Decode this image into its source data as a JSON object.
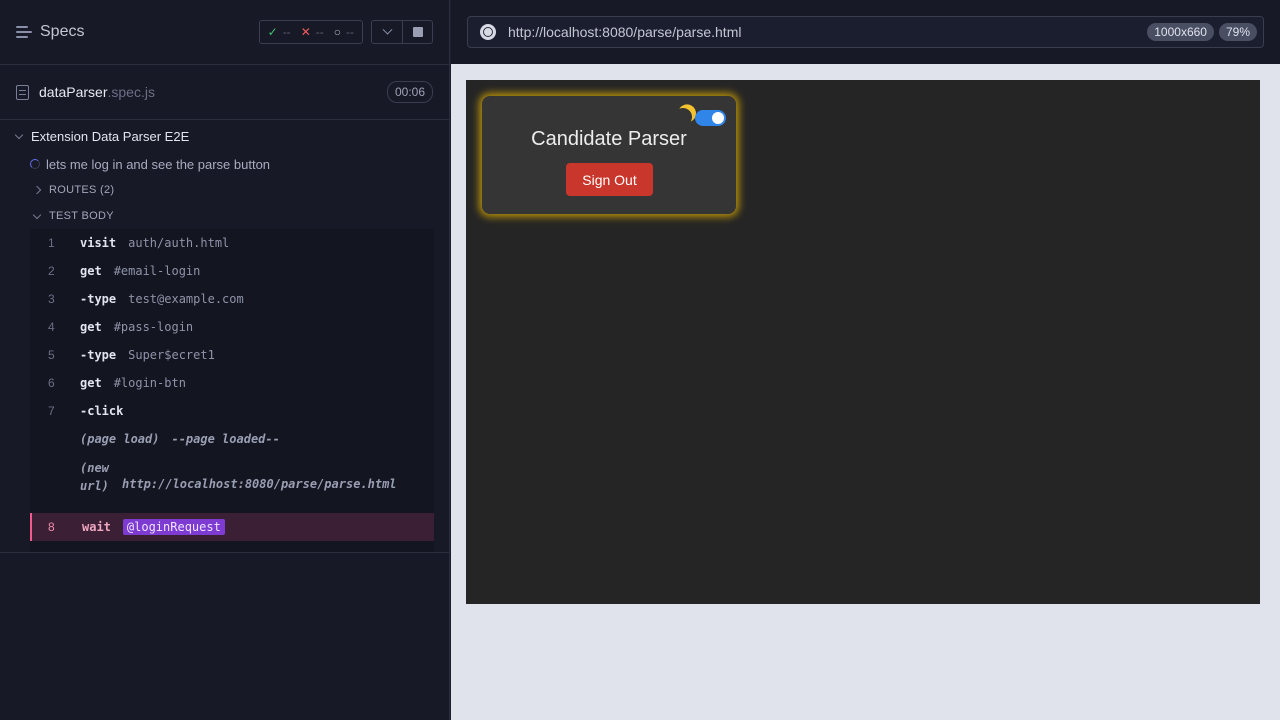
{
  "reporter": {
    "title": "Specs",
    "stats": {
      "passed": "--",
      "failed": "--",
      "pending": "--"
    },
    "file": {
      "name": "dataParser",
      "ext": ".spec.js",
      "duration": "00:06"
    },
    "suite": "Extension Data Parser E2E",
    "test": "lets me log in and see the parse button",
    "routes_label": "ROUTES (2)",
    "body_label": "TEST BODY",
    "commands": [
      {
        "num": "1",
        "name": "visit",
        "arg": "auth/auth.html"
      },
      {
        "num": "2",
        "name": "get",
        "arg": "#email-login"
      },
      {
        "num": "3",
        "name": "-type",
        "arg": "test@example.com"
      },
      {
        "num": "4",
        "name": "get",
        "arg": "#pass-login"
      },
      {
        "num": "5",
        "name": "-type",
        "arg": "Super$ecret1"
      },
      {
        "num": "6",
        "name": "get",
        "arg": "#login-btn"
      },
      {
        "num": "7",
        "name": "-click",
        "arg": ""
      },
      {
        "num": "",
        "name": "(page load)",
        "arg": "--page loaded--"
      },
      {
        "num": "",
        "name": "(new url)",
        "arg": "http://localhost:8080/parse/parse.html"
      },
      {
        "num": "8",
        "name": "wait",
        "arg": "@loginRequest"
      }
    ]
  },
  "aut": {
    "url": "http://localhost:8080/parse/parse.html",
    "viewport_size": "1000x660",
    "zoom": "79%"
  },
  "app": {
    "title": "Candidate Parser",
    "sign_out_label": "Sign Out",
    "theme_toggle_on": true
  },
  "colors": {
    "accent": "#6470f3",
    "pass": "#3fc06f",
    "fail": "#f05b5b",
    "alias": "#7d3bd1",
    "sign_out": "#c9362b",
    "toggle": "#2f86e8",
    "glow": "#e6b400"
  }
}
